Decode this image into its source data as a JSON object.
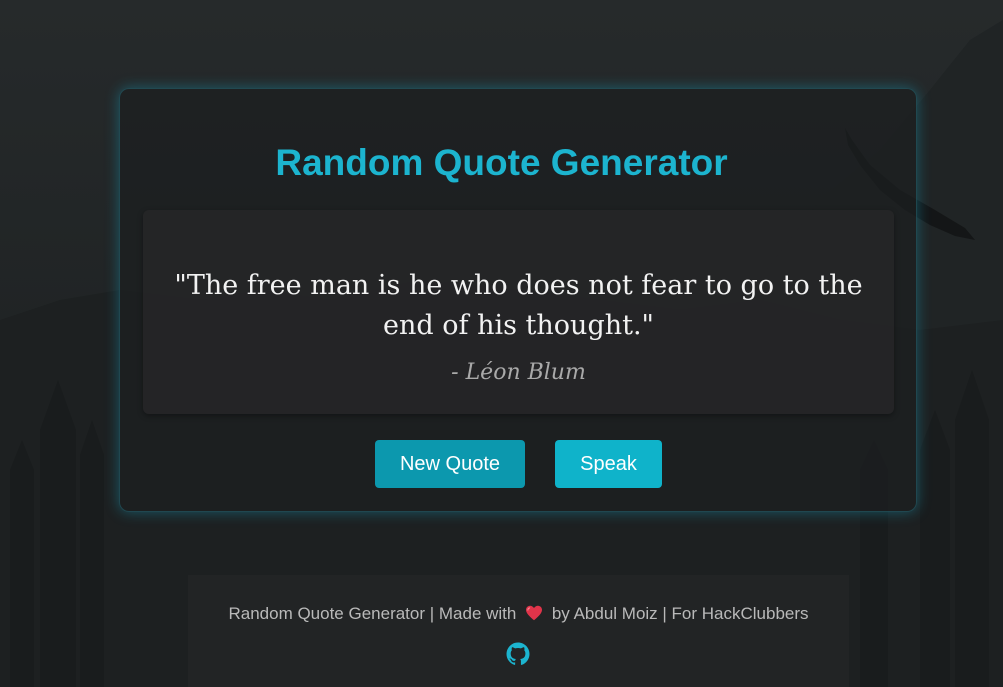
{
  "app": {
    "title": "Random Quote Generator"
  },
  "quote": {
    "text": "\"The free man is he who does not fear to go to the end of his thought.\"",
    "author": "- Léon Blum"
  },
  "buttons": {
    "new_quote": "New Quote",
    "speak": "Speak"
  },
  "footer": {
    "part1": "Random Quote Generator | Made with",
    "part2": "by Abdul Moiz | For HackClubbers",
    "heart_icon": "heart-icon",
    "github_icon": "github-icon"
  },
  "colors": {
    "accent": "#1cb4cf",
    "new_quote_button": "#0c98ae",
    "speak_button": "#0fb3ca",
    "heart": "#e0344a"
  }
}
